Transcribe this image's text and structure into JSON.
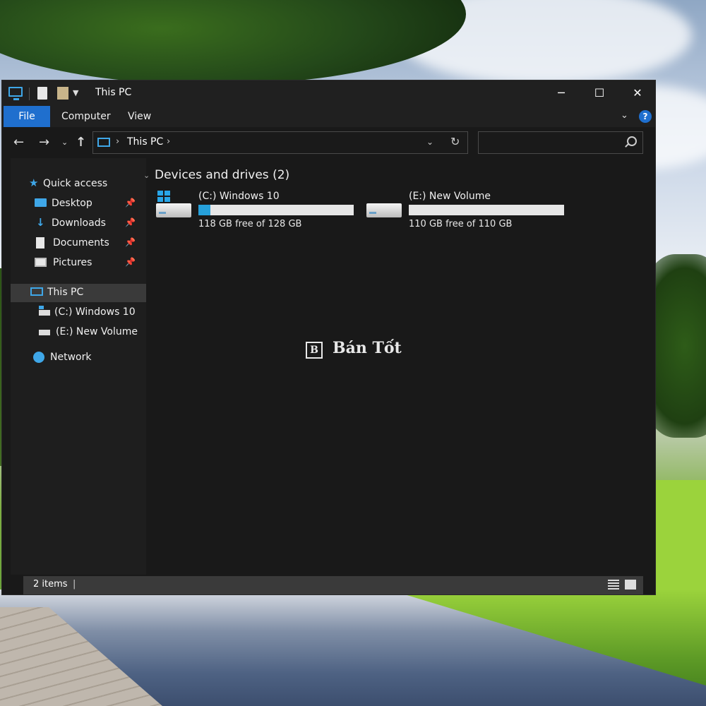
{
  "window": {
    "title": "This PC",
    "controls": {
      "minimize": "─",
      "maximize": "☐",
      "close": "✕"
    }
  },
  "ribbon": {
    "tabs": [
      {
        "label": "File",
        "active": true
      },
      {
        "label": "Computer"
      },
      {
        "label": "View"
      }
    ],
    "help": "?"
  },
  "address": {
    "path": "This PC",
    "search_placeholder": ""
  },
  "sidebar": {
    "items": [
      {
        "label": "Quick access",
        "icon": "star-icon"
      },
      {
        "label": "Desktop",
        "icon": "desktop-icon",
        "pinned": true
      },
      {
        "label": "Downloads",
        "icon": "download-icon",
        "pinned": true
      },
      {
        "label": "Documents",
        "icon": "document-icon",
        "pinned": true
      },
      {
        "label": "Pictures",
        "icon": "pictures-icon",
        "pinned": true
      },
      {
        "label": "This PC",
        "icon": "pc-icon",
        "selected": true
      },
      {
        "label": "(C:) Windows 10",
        "icon": "drive-icon"
      },
      {
        "label": "(E:) New Volume",
        "icon": "drive-icon"
      },
      {
        "label": "Network",
        "icon": "network-icon"
      }
    ]
  },
  "content": {
    "group_title": "Devices and drives (2)",
    "drives": [
      {
        "name": "(C:) Windows 10",
        "free_text": "118 GB free of 128 GB",
        "used_fraction": 0.078
      },
      {
        "name": "(E:) New Volume",
        "free_text": "110 GB free of 110 GB",
        "used_fraction": 0.0
      }
    ]
  },
  "watermark": {
    "mark": "B",
    "text": "Bán Tốt"
  },
  "status": {
    "items_count": "2 items"
  },
  "colors": {
    "accent": "#1f6fce",
    "drive_fill": "#26a0da",
    "window_bg": "#191919"
  }
}
